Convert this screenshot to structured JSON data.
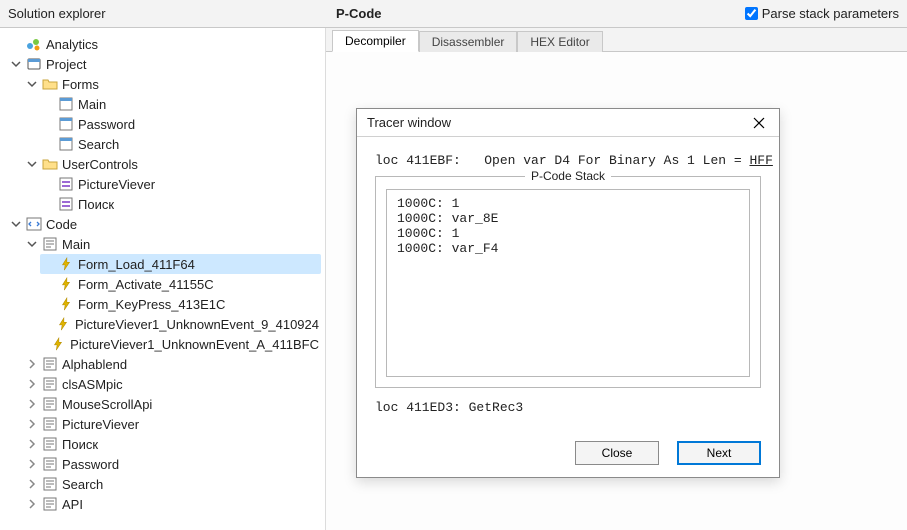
{
  "header": {
    "left_title": "Solution explorer",
    "center_title": "P-Code",
    "parse_checkbox_checked": true,
    "parse_checkbox_label": "Parse stack parameters"
  },
  "tabs": {
    "items": [
      {
        "label": "Decompiler",
        "active": true
      },
      {
        "label": "Disassembler",
        "active": false
      },
      {
        "label": "HEX Editor",
        "active": false
      }
    ]
  },
  "tree": {
    "analytics": {
      "label": "Analytics"
    },
    "project": {
      "label": "Project",
      "forms": {
        "label": "Forms",
        "items": [
          {
            "label": "Main"
          },
          {
            "label": "Password"
          },
          {
            "label": "Search"
          }
        ]
      },
      "usercontrols": {
        "label": "UserControls",
        "items": [
          {
            "label": "PictureViever"
          },
          {
            "label": "Поиск"
          }
        ]
      }
    },
    "code": {
      "label": "Code",
      "main": {
        "label": "Main",
        "items": [
          {
            "label": "Form_Load_411F64",
            "selected": true
          },
          {
            "label": "Form_Activate_41155C"
          },
          {
            "label": "Form_KeyPress_413E1C"
          },
          {
            "label": "PictureViever1_UnknownEvent_9_410924"
          },
          {
            "label": "PictureViever1_UnknownEvent_A_411BFC"
          }
        ]
      },
      "modules": [
        {
          "label": "Alphablend"
        },
        {
          "label": "clsASMpic"
        },
        {
          "label": "MouseScrollApi"
        },
        {
          "label": "PictureViever"
        },
        {
          "label": "Поиск"
        },
        {
          "label": "Password"
        },
        {
          "label": "Search"
        },
        {
          "label": "API"
        }
      ]
    }
  },
  "tracer": {
    "title": "Tracer window",
    "line1_prefix": "loc 411EBF:   Open var D4 For Binary As 1 Len = ",
    "line1_link": "HFF",
    "stack_caption": "P-Code Stack",
    "stack_lines": [
      "1000C: 1",
      "1000C: var_8E",
      "1000C: 1",
      "1000C: var_F4"
    ],
    "line2": "loc 411ED3: GetRec3",
    "close_btn": "Close",
    "next_btn": "Next"
  }
}
